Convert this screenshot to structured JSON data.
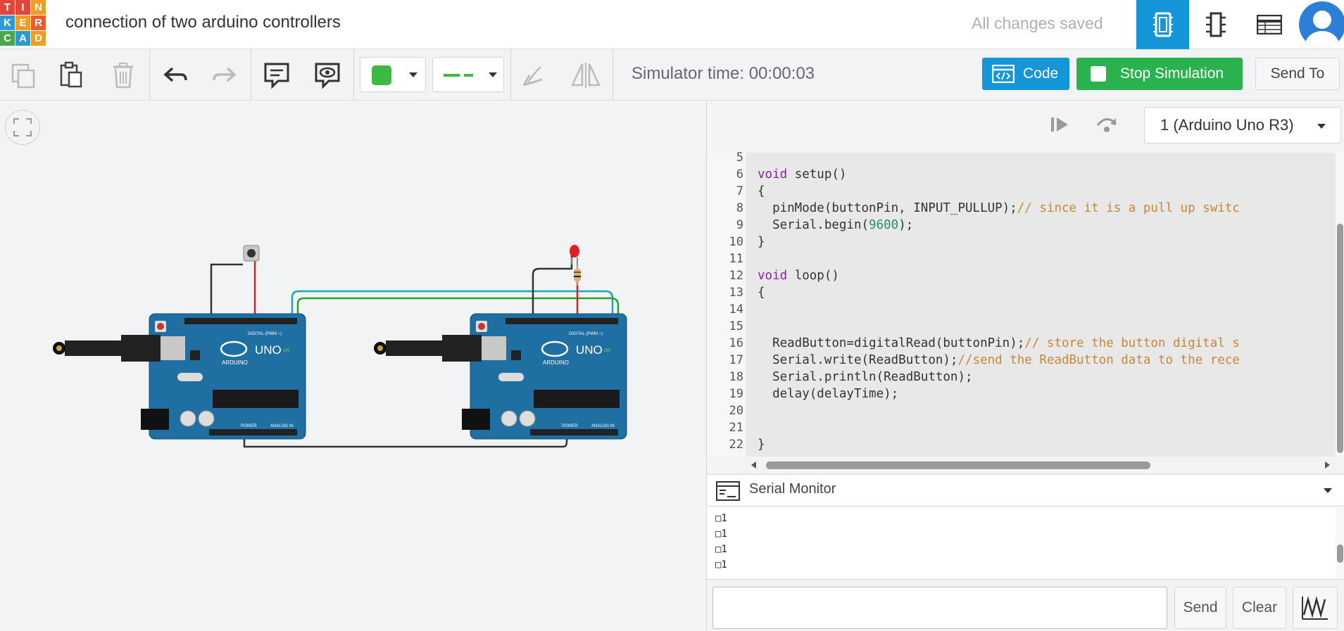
{
  "logo": {
    "letters": [
      "T",
      "I",
      "N",
      "K",
      "E",
      "R",
      "C",
      "A",
      "D"
    ],
    "colors": [
      "#e2463a",
      "#e2463a",
      "#f29c21",
      "#2d9ad1",
      "#f29c21",
      "#ee5b2c",
      "#4aa64a",
      "#2d9ad1",
      "#f29c21"
    ]
  },
  "header": {
    "title": "connection of two arduino controllers",
    "status": "All changes saved"
  },
  "view_buttons": [
    {
      "icon": "circuit-view-icon",
      "active": true
    },
    {
      "icon": "schematic-view-icon",
      "active": false
    },
    {
      "icon": "component-list-icon",
      "active": false
    }
  ],
  "toolbar": {
    "sim_time": "Simulator time: 00:00:03",
    "code_label": "Code",
    "stop_label": "Stop Simulation",
    "send_to_label": "Send To",
    "fill_color": "#3db843",
    "wire_color": "#3db843"
  },
  "code_panel": {
    "board": "1 (Arduino Uno R3)",
    "line_numbers": [
      "5",
      "6",
      "7",
      "8",
      "9",
      "10",
      "11",
      "12",
      "13",
      "14",
      "15",
      "16",
      "17",
      "18",
      "19",
      "20",
      "21",
      "22"
    ]
  },
  "code_lines": {
    "l6_kw": "void",
    "l6_rest": " setup()",
    "l7": "{",
    "l8_code": "  pinMode(buttonPin, INPUT_PULLUP);",
    "l8_comment": "// since it is a pull up switc",
    "l9_code": "  Serial.begin(",
    "l9_num": "9600",
    "l9_end": ");",
    "l10": "}",
    "l12_kw": "void",
    "l12_rest": " loop()",
    "l13": "{",
    "l16_code": "  ReadButton=digitalRead(buttonPin);",
    "l16_comment": "// store the button digital s",
    "l17_code": "  Serial.write(ReadButton);",
    "l17_comment": "//send the ReadButton data to the rece",
    "l18": "  Serial.println(ReadButton);",
    "l19": "  delay(delayTime);",
    "l22": "}"
  },
  "serial_monitor": {
    "title": "Serial Monitor",
    "output": [
      "□1",
      "□1",
      "□1",
      "□1"
    ],
    "input_value": "",
    "send_label": "Send",
    "clear_label": "Clear"
  },
  "circuit": {
    "board_left_label": "UNO",
    "board_right_label": "UNO",
    "brand": "ARDUINO",
    "digital_label": "DIGITAL (PWM ~)",
    "power_label": "POWER",
    "analog_label": "ANALOG IN",
    "on_label": "ON"
  }
}
